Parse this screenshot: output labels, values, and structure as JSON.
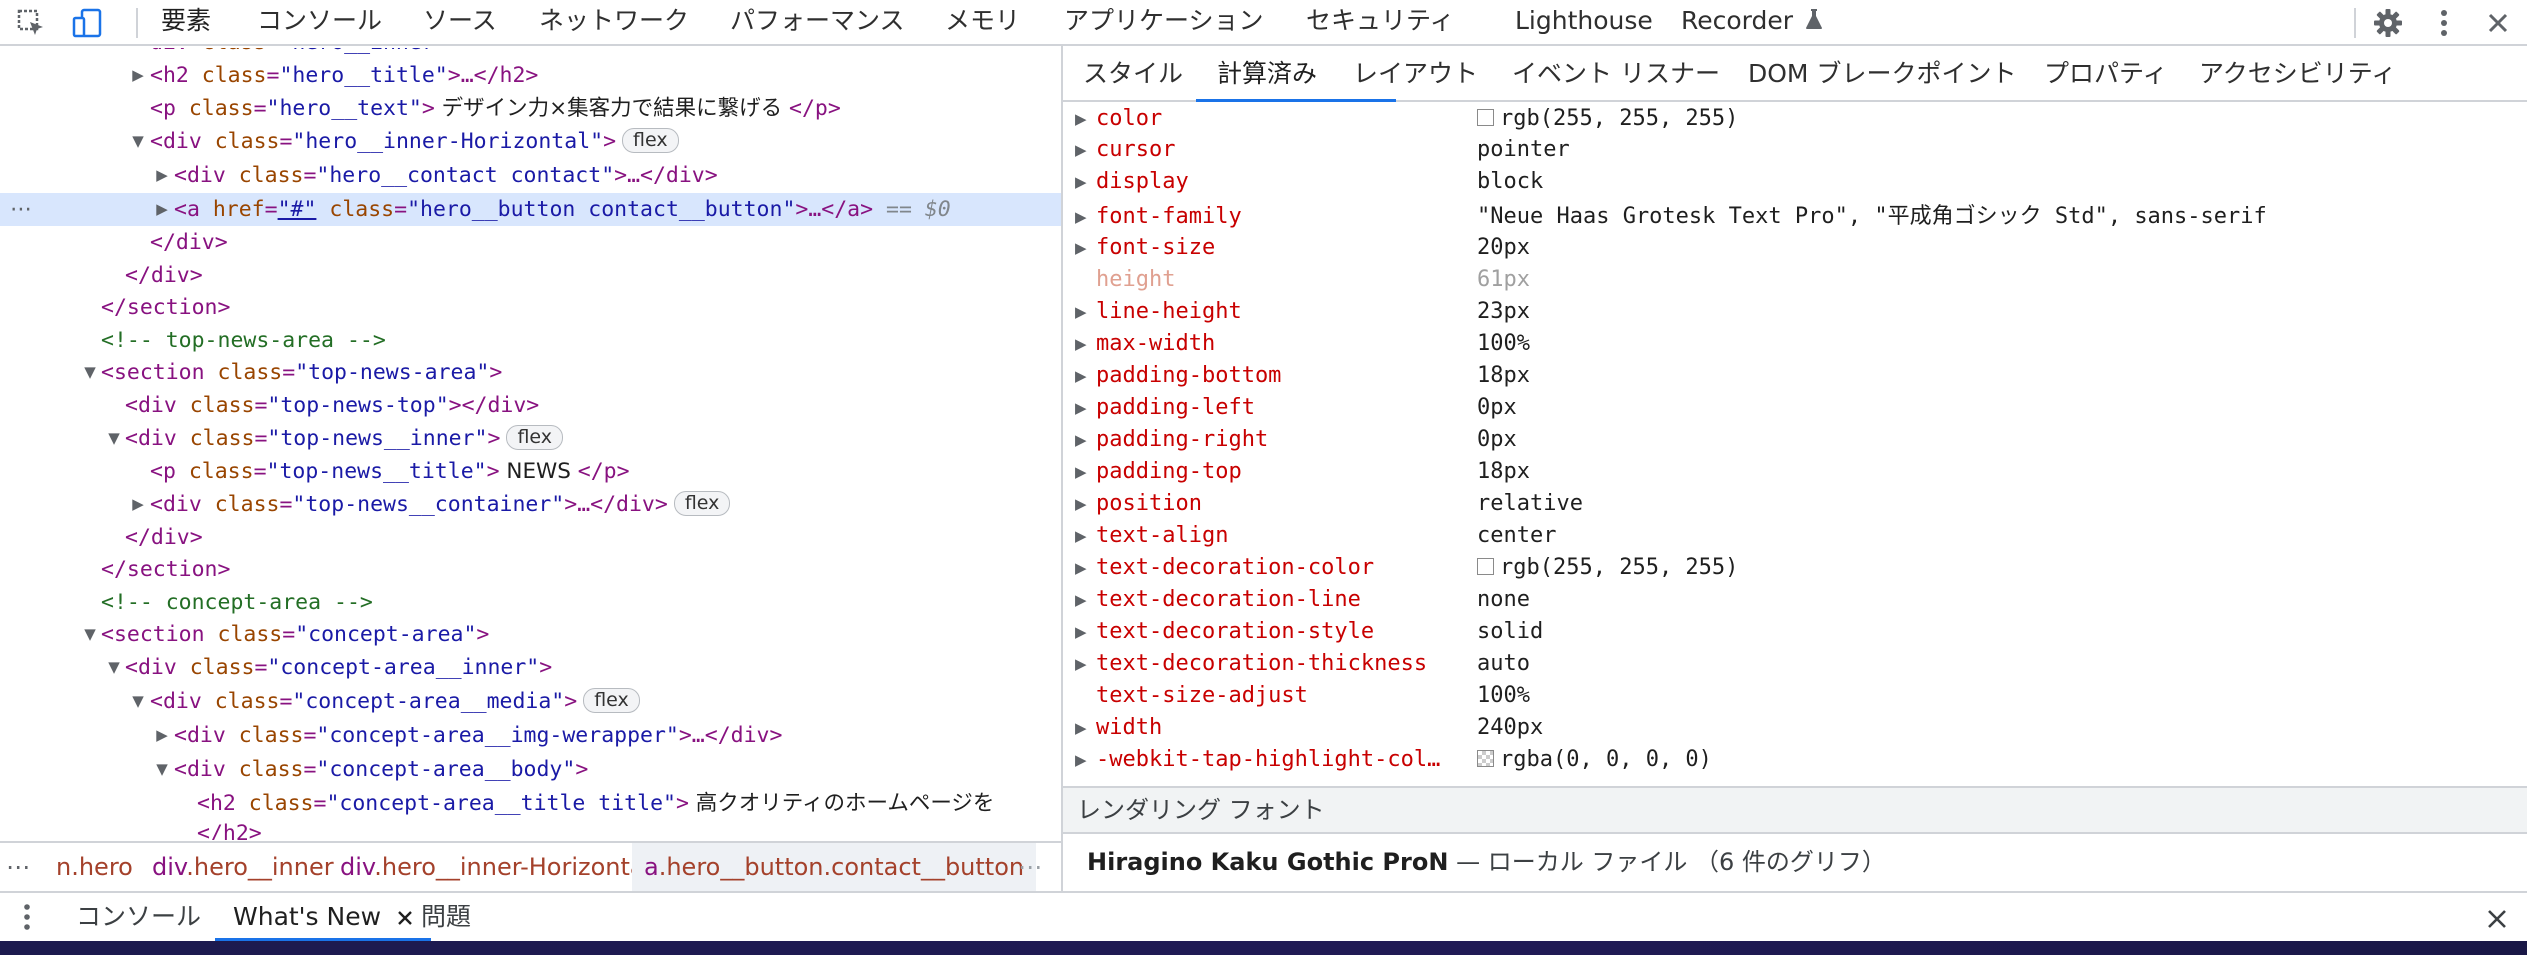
{
  "toolbar": {
    "tabs": [
      "要素",
      "コンソール",
      "ソース",
      "ネットワーク",
      "パフォーマンス",
      "メモリ",
      "アプリケーション",
      "セキュリティ",
      "Lighthouse",
      "Recorder"
    ],
    "active_tab": "要素"
  },
  "elements": {
    "lines": [
      {
        "pre": "",
        "tag_open": "<h2 ",
        "attr": "class",
        "val": "\"hero__title\"",
        "rest": ">…</h2>",
        "text": "",
        "badge": ""
      },
      {
        "pre": "",
        "tag_open": "<p ",
        "attr": "class",
        "val": "\"hero__text\"",
        "rest": ">",
        "text": " デザイン力×集客力で結果に繋げる ",
        "rest2": "</p>",
        "badge": ""
      },
      {
        "pre": "",
        "tag_open": "<div ",
        "attr": "class",
        "val": "\"hero__inner-Horizontal\"",
        "rest": ">",
        "text": "",
        "badge": "flex"
      },
      {
        "pre": "",
        "tag_open": "<div ",
        "attr": "class",
        "val": "\"hero__contact contact\"",
        "rest": ">…</div>",
        "text": "",
        "badge": ""
      },
      {
        "pre": "",
        "tag_open": "<a ",
        "attr": "href",
        "val": "\"#\"",
        "attr2": "class",
        "val2": "\"hero__button contact__button\"",
        "rest": ">…</a>",
        "text": "",
        "badge": "",
        "suffix": " == $0"
      },
      {
        "pre": "",
        "tag_open": "</div>",
        "attr": "",
        "val": "",
        "rest": "",
        "text": "",
        "badge": ""
      },
      {
        "pre": "",
        "tag_open": "</div>",
        "attr": "",
        "val": "",
        "rest": "",
        "text": "",
        "badge": ""
      },
      {
        "pre": "",
        "tag_open": "</section>",
        "attr": "",
        "val": "",
        "rest": "",
        "text": "",
        "badge": ""
      },
      {
        "comment": "<!-- top-news-area -->"
      },
      {
        "pre": "",
        "tag_open": "<section ",
        "attr": "class",
        "val": "\"top-news-area\"",
        "rest": ">",
        "text": "",
        "badge": ""
      },
      {
        "pre": "",
        "tag_open": "<div ",
        "attr": "class",
        "val": "\"top-news-top\"",
        "rest": "></div>",
        "text": "",
        "badge": ""
      },
      {
        "pre": "",
        "tag_open": "<div ",
        "attr": "class",
        "val": "\"top-news__inner\"",
        "rest": ">",
        "text": "",
        "badge": "flex"
      },
      {
        "pre": "",
        "tag_open": "<p ",
        "attr": "class",
        "val": "\"top-news__title\"",
        "rest": ">",
        "text": " NEWS ",
        "rest2": "</p>",
        "badge": ""
      },
      {
        "pre": "",
        "tag_open": "<div ",
        "attr": "class",
        "val": "\"top-news__container\"",
        "rest": ">…</div>",
        "text": "",
        "badge": "flex"
      },
      {
        "pre": "",
        "tag_open": "</div>",
        "attr": "",
        "val": "",
        "rest": "",
        "text": "",
        "badge": ""
      },
      {
        "pre": "",
        "tag_open": "</section>",
        "attr": "",
        "val": "",
        "rest": "",
        "text": "",
        "badge": ""
      },
      {
        "comment": "<!-- concept-area -->"
      },
      {
        "pre": "",
        "tag_open": "<section ",
        "attr": "class",
        "val": "\"concept-area\"",
        "rest": ">",
        "text": "",
        "badge": ""
      },
      {
        "pre": "",
        "tag_open": "<div ",
        "attr": "class",
        "val": "\"concept-area__inner\"",
        "rest": ">",
        "text": "",
        "badge": ""
      },
      {
        "pre": "",
        "tag_open": "<div ",
        "attr": "class",
        "val": "\"concept-area__media\"",
        "rest": ">",
        "text": "",
        "badge": "flex"
      },
      {
        "pre": "",
        "tag_open": "<div ",
        "attr": "class",
        "val": "\"concept-area__img-werapper\"",
        "rest": ">…</div>",
        "text": "",
        "badge": ""
      },
      {
        "pre": "",
        "tag_open": "<div ",
        "attr": "class",
        "val": "\"concept-area__body\"",
        "rest": ">",
        "text": "",
        "badge": ""
      },
      {
        "pre": "",
        "tag_open": "<h2 ",
        "attr": "class",
        "val": "\"concept-area__title title\"",
        "rest": ">",
        "text": " 高クオリティのホームページを",
        "badge": ""
      },
      {
        "pre": "",
        "tag_open": "</h2>",
        "attr": "",
        "val": "",
        "rest": "",
        "text": "",
        "badge": ""
      }
    ]
  },
  "breadcrumbs": [
    {
      "tag": "",
      "cls": "n.hero"
    },
    {
      "tag": "div",
      "cls": ".hero__inner"
    },
    {
      "tag": "div",
      "cls": ".hero__inner-Horizontal"
    },
    {
      "tag": "a",
      "cls": ".hero__button.contact__button"
    }
  ],
  "subtabs": {
    "items": [
      "スタイル",
      "計算済み",
      "レイアウト",
      "イベント リスナー",
      "DOM ブレークポイント",
      "プロパティ",
      "アクセシビリティ"
    ],
    "active": "計算済み"
  },
  "computed": [
    {
      "name": "color",
      "value": "rgb(255, 255, 255)",
      "swatch": "white",
      "expandable": true
    },
    {
      "name": "cursor",
      "value": "pointer",
      "expandable": true
    },
    {
      "name": "display",
      "value": "block",
      "expandable": true
    },
    {
      "name": "font-family",
      "value": "\"Neue Haas Grotesk Text Pro\", \"平成角ゴシック Std\", sans-serif",
      "expandable": true
    },
    {
      "name": "font-size",
      "value": "20px",
      "expandable": true
    },
    {
      "name": "height",
      "value": "61px",
      "expandable": false,
      "inherited": true
    },
    {
      "name": "line-height",
      "value": "23px",
      "expandable": true
    },
    {
      "name": "max-width",
      "value": "100%",
      "expandable": true
    },
    {
      "name": "padding-bottom",
      "value": "18px",
      "expandable": true
    },
    {
      "name": "padding-left",
      "value": "0px",
      "expandable": true
    },
    {
      "name": "padding-right",
      "value": "0px",
      "expandable": true
    },
    {
      "name": "padding-top",
      "value": "18px",
      "expandable": true
    },
    {
      "name": "position",
      "value": "relative",
      "expandable": true
    },
    {
      "name": "text-align",
      "value": "center",
      "expandable": true
    },
    {
      "name": "text-decoration-color",
      "value": "rgb(255, 255, 255)",
      "swatch": "white",
      "expandable": true
    },
    {
      "name": "text-decoration-line",
      "value": "none",
      "expandable": true
    },
    {
      "name": "text-decoration-style",
      "value": "solid",
      "expandable": true
    },
    {
      "name": "text-decoration-thickness",
      "value": "auto",
      "expandable": true
    },
    {
      "name": "text-size-adjust",
      "value": "100%",
      "expandable": false
    },
    {
      "name": "width",
      "value": "240px",
      "expandable": true
    },
    {
      "name": "-webkit-tap-highlight-col…",
      "value": "rgba(0, 0, 0, 0)",
      "swatch": "checker",
      "expandable": true
    }
  ],
  "rendered_fonts": {
    "header": "レンダリング フォント",
    "font_name": "Hiragino Kaku Gothic ProN",
    "dash": " — ",
    "detail": "ローカル ファイル （6 件のグリフ）"
  },
  "drawer": {
    "tabs": [
      "コンソール",
      "What's New",
      "問題"
    ],
    "active": "What's New"
  },
  "colors": {
    "accent": "#1a73e8",
    "selection": "#d8e6fd",
    "tag": "#881280",
    "attr": "#994500",
    "value": "#1a1aa6",
    "prop_name": "#c80000"
  }
}
